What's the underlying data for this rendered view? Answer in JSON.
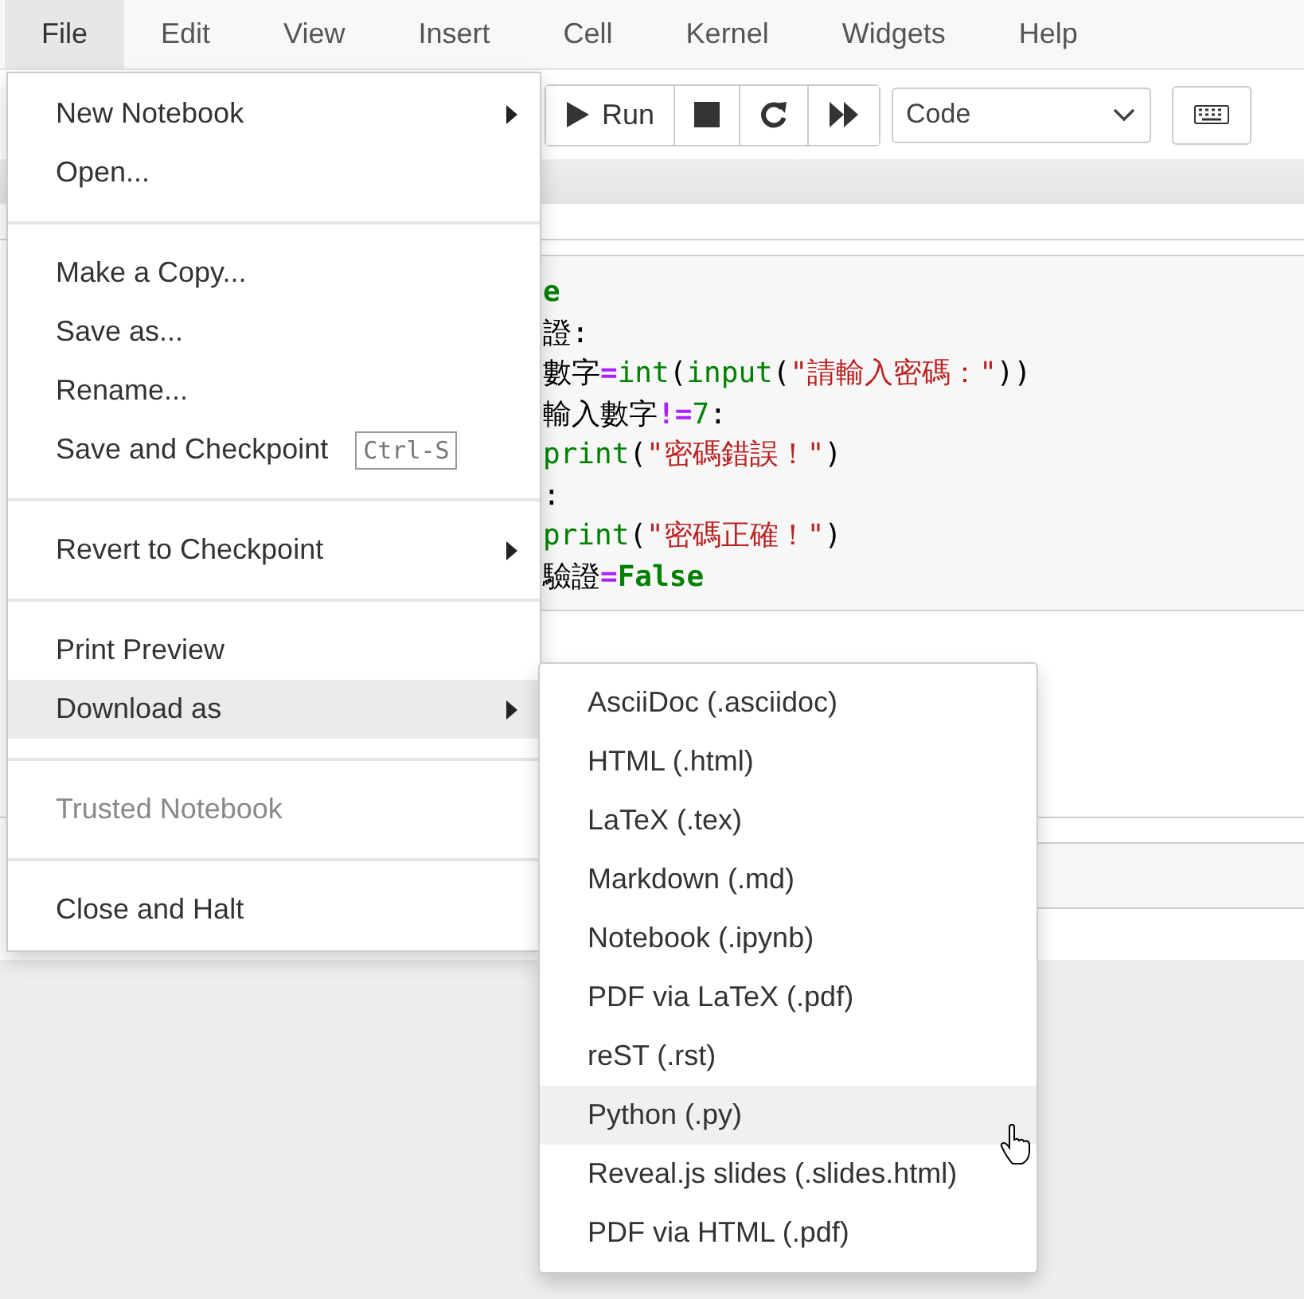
{
  "menubar": [
    {
      "label": "File",
      "selected": true
    },
    {
      "label": "Edit",
      "selected": false
    },
    {
      "label": "View",
      "selected": false
    },
    {
      "label": "Insert",
      "selected": false
    },
    {
      "label": "Cell",
      "selected": false
    },
    {
      "label": "Kernel",
      "selected": false
    },
    {
      "label": "Widgets",
      "selected": false
    },
    {
      "label": "Help",
      "selected": false
    }
  ],
  "toolbar": {
    "run_label": "Run",
    "cell_type": "Code"
  },
  "code_lines": [
    [
      {
        "text": "e",
        "kind": "keyword"
      }
    ],
    [
      {
        "text": "證:",
        "kind": "plain"
      }
    ],
    [
      {
        "text": "數字",
        "kind": "plain"
      },
      {
        "text": "=",
        "kind": "op"
      },
      {
        "text": "int",
        "kind": "builtin"
      },
      {
        "text": "(",
        "kind": "plain"
      },
      {
        "text": "input",
        "kind": "builtin"
      },
      {
        "text": "(",
        "kind": "plain"
      },
      {
        "text": "\"請輸入密碼：\"",
        "kind": "string"
      },
      {
        "text": "))",
        "kind": "plain"
      }
    ],
    [
      {
        "text": "輸入數字",
        "kind": "plain"
      },
      {
        "text": "!=",
        "kind": "op"
      },
      {
        "text": "7",
        "kind": "number"
      },
      {
        "text": ":",
        "kind": "plain"
      }
    ],
    [
      {
        "text": "print",
        "kind": "builtin"
      },
      {
        "text": "(",
        "kind": "plain"
      },
      {
        "text": "\"密碼錯誤！\"",
        "kind": "string"
      },
      {
        "text": ")",
        "kind": "plain"
      }
    ],
    [
      {
        "text": ":",
        "kind": "plain"
      }
    ],
    [
      {
        "text": "print",
        "kind": "builtin"
      },
      {
        "text": "(",
        "kind": "plain"
      },
      {
        "text": "\"密碼正確！\"",
        "kind": "string"
      },
      {
        "text": ")",
        "kind": "plain"
      }
    ],
    [
      {
        "text": "驗證",
        "kind": "plain"
      },
      {
        "text": "=",
        "kind": "op"
      },
      {
        "text": "False",
        "kind": "keyword"
      }
    ]
  ],
  "file_menu": [
    [
      {
        "label": "New Notebook",
        "submenu": true,
        "selected": false,
        "disabled": false
      },
      {
        "label": "Open...",
        "submenu": false,
        "selected": false,
        "disabled": false
      }
    ],
    [
      {
        "label": "Make a Copy...",
        "submenu": false,
        "selected": false,
        "disabled": false
      },
      {
        "label": "Save as...",
        "submenu": false,
        "selected": false,
        "disabled": false
      },
      {
        "label": "Rename...",
        "submenu": false,
        "selected": false,
        "disabled": false
      },
      {
        "label": "Save and Checkpoint",
        "shortcut": "Ctrl-S",
        "submenu": false,
        "selected": false,
        "disabled": false
      }
    ],
    [
      {
        "label": "Revert to Checkpoint",
        "submenu": true,
        "selected": false,
        "disabled": false
      }
    ],
    [
      {
        "label": "Print Preview",
        "submenu": false,
        "selected": false,
        "disabled": false
      },
      {
        "label": "Download as",
        "submenu": true,
        "selected": true,
        "disabled": false
      }
    ],
    [
      {
        "label": "Trusted Notebook",
        "submenu": false,
        "selected": false,
        "disabled": true
      }
    ],
    [
      {
        "label": "Close and Halt",
        "submenu": false,
        "selected": false,
        "disabled": false
      }
    ]
  ],
  "download_menu": [
    {
      "label": "AsciiDoc (.asciidoc)",
      "selected": false
    },
    {
      "label": "HTML (.html)",
      "selected": false
    },
    {
      "label": "LaTeX (.tex)",
      "selected": false
    },
    {
      "label": "Markdown (.md)",
      "selected": false
    },
    {
      "label": "Notebook (.ipynb)",
      "selected": false
    },
    {
      "label": "PDF via LaTeX (.pdf)",
      "selected": false
    },
    {
      "label": "reST (.rst)",
      "selected": false
    },
    {
      "label": "Python (.py)",
      "selected": true
    },
    {
      "label": "Reveal.js slides (.slides.html)",
      "selected": false
    },
    {
      "label": "PDF via HTML (.pdf)",
      "selected": false
    }
  ]
}
